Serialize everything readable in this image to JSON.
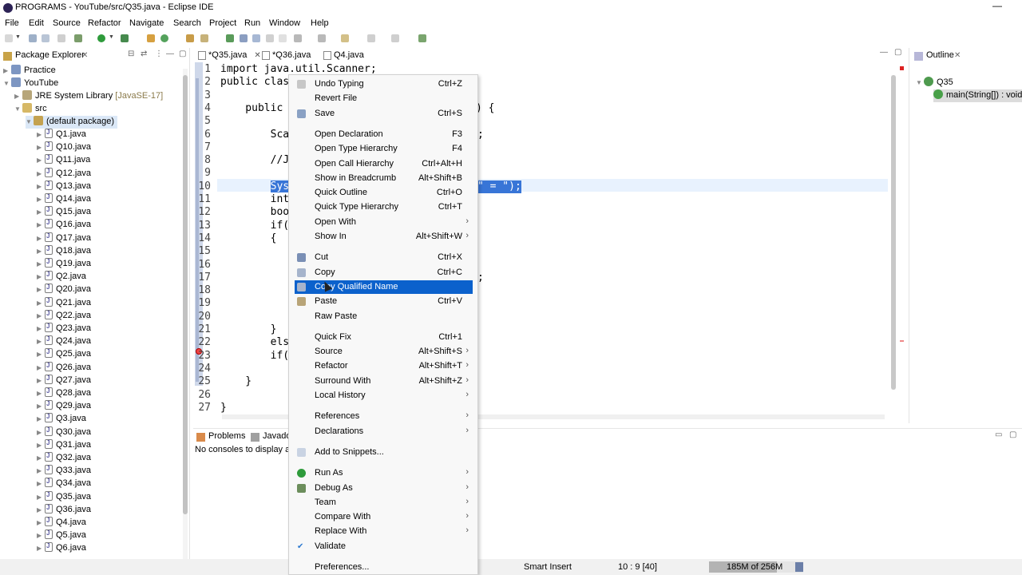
{
  "window": {
    "title": "PROGRAMS - YouTube/src/Q35.java - Eclipse IDE",
    "minimize": "—"
  },
  "menubar": [
    "File",
    "Edit",
    "Source",
    "Refactor",
    "Navigate",
    "Search",
    "Project",
    "Run",
    "Window",
    "Help"
  ],
  "package_explorer": {
    "tab_label": "Package Explorer",
    "projects": [
      {
        "label": "Practice"
      },
      {
        "label": "YouTube"
      }
    ],
    "jre": {
      "label": "JRE System Library",
      "decoration": "[JavaSE-17]"
    },
    "src": "src",
    "package": "(default package)",
    "files": [
      "Q1.java",
      "Q10.java",
      "Q11.java",
      "Q12.java",
      "Q13.java",
      "Q14.java",
      "Q15.java",
      "Q16.java",
      "Q17.java",
      "Q18.java",
      "Q19.java",
      "Q2.java",
      "Q20.java",
      "Q21.java",
      "Q22.java",
      "Q23.java",
      "Q24.java",
      "Q25.java",
      "Q26.java",
      "Q27.java",
      "Q28.java",
      "Q29.java",
      "Q3.java",
      "Q30.java",
      "Q31.java",
      "Q32.java",
      "Q33.java",
      "Q34.java",
      "Q35.java",
      "Q36.java",
      "Q4.java",
      "Q5.java",
      "Q6.java"
    ]
  },
  "editor": {
    "tabs": [
      "*Q35.java",
      "*Q36.java",
      "Q4.java"
    ],
    "lines": [
      {
        "n": "1",
        "code": "import java.util.Scanner;",
        "tail": ""
      },
      {
        "n": "2",
        "code": "public clas",
        "tail": ""
      },
      {
        "n": "3",
        "code": "",
        "tail": ""
      },
      {
        "n": "4",
        "code": "    public ",
        "tail": ") {"
      },
      {
        "n": "5",
        "code": "",
        "tail": ""
      },
      {
        "n": "6",
        "code": "        Sca",
        "tail": ";"
      },
      {
        "n": "7",
        "code": "",
        "tail": ""
      },
      {
        "n": "8",
        "code": "        //J",
        "tail": ""
      },
      {
        "n": "9",
        "code": "",
        "tail": ""
      },
      {
        "n": "10",
        "code": "        Sys",
        "tail": "\" = \");"
      },
      {
        "n": "11",
        "code": "        int",
        "tail": ""
      },
      {
        "n": "12",
        "code": "        boo",
        "tail": ""
      },
      {
        "n": "13",
        "code": "        if(",
        "tail": ""
      },
      {
        "n": "14",
        "code": "        {",
        "tail": ""
      },
      {
        "n": "15",
        "code": "",
        "tail": ""
      },
      {
        "n": "16",
        "code": "",
        "tail": ""
      },
      {
        "n": "17",
        "code": "",
        "tail": ";"
      },
      {
        "n": "18",
        "code": "",
        "tail": ""
      },
      {
        "n": "19",
        "code": "",
        "tail": ""
      },
      {
        "n": "20",
        "code": "",
        "tail": ""
      },
      {
        "n": "21",
        "code": "        }",
        "tail": ""
      },
      {
        "n": "22",
        "code": "        els",
        "tail": ""
      },
      {
        "n": "23",
        "code": "        if(",
        "tail": ""
      },
      {
        "n": "24",
        "code": "",
        "tail": ""
      },
      {
        "n": "25",
        "code": "    }",
        "tail": ""
      },
      {
        "n": "26",
        "code": "",
        "tail": ""
      },
      {
        "n": "27",
        "code": "}",
        "tail": ""
      }
    ]
  },
  "outline": {
    "tab_label": "Outline",
    "class": "Q35",
    "method": "main(String[]) : void"
  },
  "console": {
    "tabs": [
      "Problems",
      "Javadoc"
    ],
    "message": "No consoles to display at"
  },
  "status": {
    "mode": "Smart Insert",
    "position": "10 : 9 [40]",
    "heap": "185M of 256M",
    "heap_used_fraction": 0.72
  },
  "context_menu": {
    "highlighted": "Copy Qualified Name",
    "items": [
      {
        "label": "Undo Typing",
        "accel": "Ctrl+Z",
        "icon": "undo-icon"
      },
      {
        "label": "Revert File",
        "accel": ""
      },
      {
        "label": "Save",
        "accel": "Ctrl+S",
        "icon": "save-icon"
      },
      {
        "sep": true
      },
      {
        "label": "Open Declaration",
        "accel": "F3"
      },
      {
        "label": "Open Type Hierarchy",
        "accel": "F4"
      },
      {
        "label": "Open Call Hierarchy",
        "accel": "Ctrl+Alt+H"
      },
      {
        "label": "Show in Breadcrumb",
        "accel": "Alt+Shift+B"
      },
      {
        "label": "Quick Outline",
        "accel": "Ctrl+O"
      },
      {
        "label": "Quick Type Hierarchy",
        "accel": "Ctrl+T"
      },
      {
        "label": "Open With",
        "accel": "",
        "submenu": true
      },
      {
        "label": "Show In",
        "accel": "Alt+Shift+W",
        "submenu": true
      },
      {
        "sep": true
      },
      {
        "label": "Cut",
        "accel": "Ctrl+X",
        "icon": "cut-icon"
      },
      {
        "label": "Copy",
        "accel": "Ctrl+C",
        "icon": "copy-icon"
      },
      {
        "label": "Copy Qualified Name",
        "accel": "",
        "icon": "copy-icon"
      },
      {
        "label": "Paste",
        "accel": "Ctrl+V",
        "icon": "paste-icon"
      },
      {
        "label": "Raw Paste",
        "accel": ""
      },
      {
        "sep": true
      },
      {
        "label": "Quick Fix",
        "accel": "Ctrl+1"
      },
      {
        "label": "Source",
        "accel": "Alt+Shift+S",
        "submenu": true
      },
      {
        "label": "Refactor",
        "accel": "Alt+Shift+T",
        "submenu": true
      },
      {
        "label": "Surround With",
        "accel": "Alt+Shift+Z",
        "submenu": true
      },
      {
        "label": "Local History",
        "accel": "",
        "submenu": true
      },
      {
        "sep": true
      },
      {
        "label": "References",
        "accel": "",
        "submenu": true
      },
      {
        "label": "Declarations",
        "accel": "",
        "submenu": true
      },
      {
        "sep": true
      },
      {
        "label": "Add to Snippets...",
        "accel": "",
        "icon": "snippet-icon"
      },
      {
        "sep": true
      },
      {
        "label": "Run As",
        "accel": "",
        "submenu": true,
        "icon": "run-icon"
      },
      {
        "label": "Debug As",
        "accel": "",
        "submenu": true,
        "icon": "debug-icon"
      },
      {
        "label": "Team",
        "accel": "",
        "submenu": true
      },
      {
        "label": "Compare With",
        "accel": "",
        "submenu": true
      },
      {
        "label": "Replace With",
        "accel": "",
        "submenu": true
      },
      {
        "label": "Validate",
        "accel": "",
        "icon": "check-icon"
      },
      {
        "sep": true
      },
      {
        "label": "Preferences...",
        "accel": ""
      }
    ]
  }
}
